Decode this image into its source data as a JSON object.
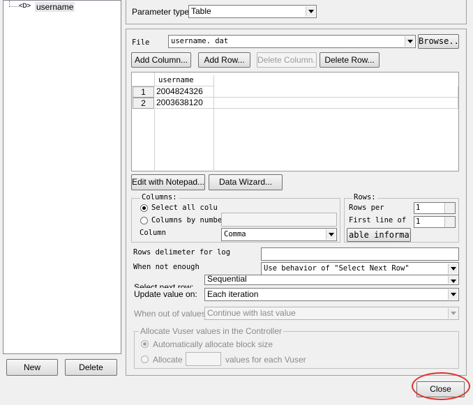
{
  "tree": {
    "node_label": "username",
    "node_icon": "<D>"
  },
  "left_buttons": {
    "new": "New",
    "delete": "Delete"
  },
  "param_type": {
    "label": "Parameter type:",
    "value": "Table"
  },
  "file": {
    "label": "File",
    "value": "username. dat",
    "browse": "Browse..."
  },
  "grid_buttons": {
    "add_column": "Add Column...",
    "add_row": "Add Row...",
    "delete_column": "Delete Column...",
    "delete_row": "Delete Row..."
  },
  "grid": {
    "header": "username",
    "rows": [
      {
        "num": "1",
        "value": "2004824326"
      },
      {
        "num": "2",
        "value": "2003638120"
      }
    ]
  },
  "edit_buttons": {
    "notepad": "Edit with Notepad...",
    "wizard": "Data Wizard..."
  },
  "columns_group": {
    "title": "Columns:",
    "select_all": "Select all colu",
    "by_number": "Columns by numbe",
    "column_label": "Column",
    "column_value": "Comma"
  },
  "rows_group": {
    "title": "Rows:",
    "rows_per": "Rows per",
    "rows_per_value": "1",
    "first_line": "First line of",
    "first_line_value": "1",
    "table_info": "able informatic"
  },
  "delimiter": {
    "label": "Rows delimeter for log",
    "value": ""
  },
  "not_enough": {
    "label": "When not enough",
    "value": "Use behavior of \"Select Next Row\""
  },
  "select_next_row": {
    "label": "Select next row:",
    "value": "Sequential"
  },
  "update_value": {
    "label": "Update value on:",
    "value": "Each iteration"
  },
  "out_of_values": {
    "label": "When out of values:",
    "value": "Continue with last value"
  },
  "allocate_group": {
    "title": "Allocate Vuser values in the Controller",
    "auto": "Automatically allocate block size",
    "allocate": "Allocate",
    "per_vuser": "values for each Vuser"
  },
  "close_button": "Close",
  "colors": {
    "highlight_circle": "#e0302a",
    "window_bg": "#f0f0f0"
  }
}
